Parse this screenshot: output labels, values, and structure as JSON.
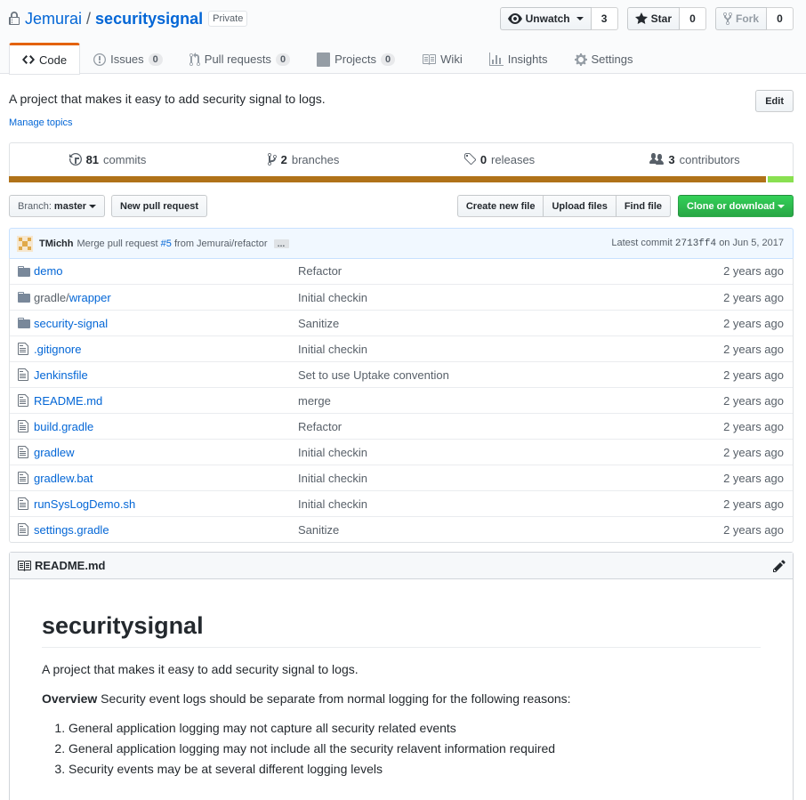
{
  "repo": {
    "owner": "Jemurai",
    "slash": "/",
    "name": "securitysignal",
    "visibility": "Private"
  },
  "actions": {
    "watch_label": "Unwatch",
    "watch_count": "3",
    "star_label": "Star",
    "star_count": "0",
    "fork_label": "Fork",
    "fork_count": "0"
  },
  "tabs": [
    {
      "label": "Code",
      "icon": "code-icon"
    },
    {
      "label": "Issues",
      "count": "0",
      "icon": "issue-icon"
    },
    {
      "label": "Pull requests",
      "count": "0",
      "icon": "pull-request-icon"
    },
    {
      "label": "Projects",
      "count": "0",
      "icon": "project-icon"
    },
    {
      "label": "Wiki",
      "icon": "book-icon"
    },
    {
      "label": "Insights",
      "icon": "graph-icon"
    },
    {
      "label": "Settings",
      "icon": "gear-icon"
    }
  ],
  "description": "A project that makes it easy to add security signal to logs.",
  "manage_topics": "Manage topics",
  "edit_label": "Edit",
  "summary": {
    "commits_count": "81",
    "commits_label": "commits",
    "branches_count": "2",
    "branches_label": "branches",
    "releases_count": "0",
    "releases_label": "releases",
    "contributors_count": "3",
    "contributors_label": "contributors"
  },
  "languages": [
    {
      "color": "#b07219",
      "percent": 96.5
    },
    {
      "color": "#89e051",
      "percent": 3.5
    }
  ],
  "branch": {
    "prefix": "Branch:",
    "name": "master"
  },
  "new_pr_label": "New pull request",
  "file_actions": {
    "create": "Create new file",
    "upload": "Upload files",
    "find": "Find file",
    "clone": "Clone or download"
  },
  "commit": {
    "author": "TMichh",
    "message_prefix": "Merge pull request",
    "pr_link": "#5",
    "message_suffix": "from Jemurai/refactor",
    "ellipsis": "…",
    "latest_prefix": "Latest commit",
    "sha": "2713ff4",
    "date_prefix": "on",
    "date": "Jun 5, 2017"
  },
  "files": [
    {
      "type": "dir",
      "name": "demo",
      "message": "Refactor",
      "age": "2 years ago"
    },
    {
      "type": "dir",
      "name_prefix": "gradle/",
      "name": "wrapper",
      "message": "Initial checkin",
      "age": "2 years ago"
    },
    {
      "type": "dir",
      "name": "security-signal",
      "message": "Sanitize",
      "age": "2 years ago"
    },
    {
      "type": "file",
      "name": ".gitignore",
      "message": "Initial checkin",
      "age": "2 years ago"
    },
    {
      "type": "file",
      "name": "Jenkinsfile",
      "message": "Set to use Uptake convention",
      "age": "2 years ago"
    },
    {
      "type": "file",
      "name": "README.md",
      "message": "merge",
      "age": "2 years ago"
    },
    {
      "type": "file",
      "name": "build.gradle",
      "message": "Refactor",
      "age": "2 years ago"
    },
    {
      "type": "file",
      "name": "gradlew",
      "message": "Initial checkin",
      "age": "2 years ago"
    },
    {
      "type": "file",
      "name": "gradlew.bat",
      "message": "Initial checkin",
      "age": "2 years ago"
    },
    {
      "type": "file",
      "name": "runSysLogDemo.sh",
      "message": "Initial checkin",
      "age": "2 years ago"
    },
    {
      "type": "file",
      "name": "settings.gradle",
      "message": "Sanitize",
      "age": "2 years ago"
    }
  ],
  "readme": {
    "filename": "README.md",
    "heading": "securitysignal",
    "intro": "A project that makes it easy to add security signal to logs.",
    "overview_bold": "Overview",
    "overview_text": " Security event logs should be separate from normal logging for the following reasons:",
    "reasons": [
      "General application logging may not capture all security related events",
      "General application logging may not include all the security relavent information required",
      "Security events may be at several different logging levels"
    ]
  },
  "colors": {
    "link": "#0366d6",
    "tab_accent": "#e36209",
    "clone_green": "#28a745",
    "commit_bg": "#f1f8ff"
  }
}
